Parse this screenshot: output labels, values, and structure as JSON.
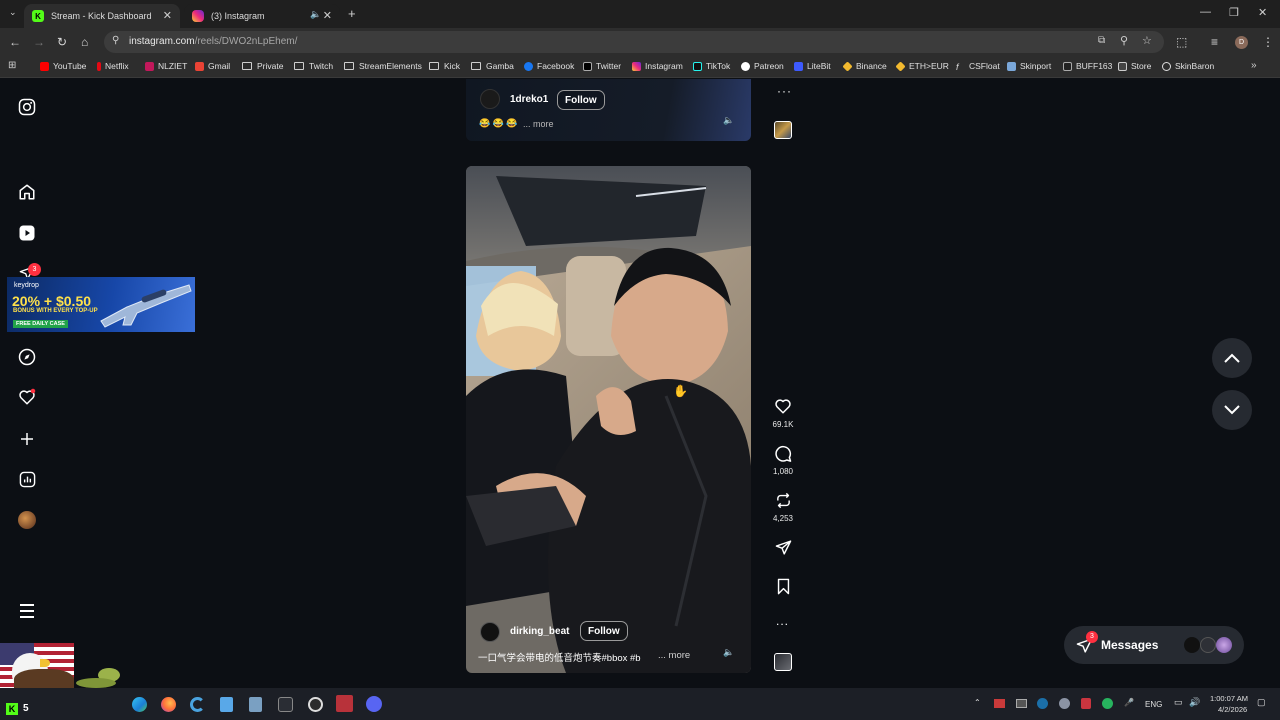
{
  "browser": {
    "tabs": [
      {
        "title": "Stream - Kick Dashboard",
        "icon": "kick-icon",
        "active": true
      },
      {
        "title": "(3) Instagram",
        "icon": "instagram-icon",
        "active": false
      }
    ],
    "new_tab_glyph": "+",
    "url": {
      "host": "instagram.com",
      "path": "/reels/DWO2nLpEhem/"
    },
    "bookmarks": [
      "YouTube",
      "Netflix",
      "NLZIET",
      "Gmail",
      "Private",
      "Twitch",
      "StreamElements",
      "Kick",
      "Gamba",
      "Facebook",
      "Twitter",
      "Instagram",
      "TikTok",
      "Patreon",
      "LiteBit",
      "Binance",
      "ETH>EUR",
      "CSFloat",
      "Skinport",
      "BUFF163",
      "Store",
      "SkinBaron"
    ]
  },
  "sidebar": {
    "notification_badge": "3",
    "icons": [
      "instagram-logo-icon",
      "home-icon",
      "reels-icon",
      "messages-icon",
      "explore-icon",
      "notifications-heart-icon",
      "create-plus-icon",
      "dashboard-icon",
      "profile-avatar",
      "menu-icon"
    ]
  },
  "ad": {
    "brand": "keydrop",
    "headline": "20% + $0.50",
    "subline": "BONUS WITH EVERY TOP-UP",
    "tag": "FREE DAILY CASE"
  },
  "reel_top": {
    "username": "1dreko1",
    "follow_label": "Follow",
    "caption_emoji": "😂 😂 😂",
    "more_label": "... more"
  },
  "reel_main": {
    "username": "dirking_beat",
    "follow_label": "Follow",
    "caption": "一口气学会带电的低音炮节奏#bbox #b",
    "more_label": "... more"
  },
  "actions": {
    "likes": "69.1K",
    "comments": "1,080",
    "reposts": "4,253",
    "more_glyph": "..."
  },
  "messages": {
    "label": "Messages",
    "badge": "3"
  },
  "taskbar": {
    "kick_count": "5",
    "language": "ENG",
    "time": "1:00:07 AM",
    "date": "4/2/2026"
  },
  "colors": {
    "accent_kick": "#53fc18",
    "badge_red": "#ff3040",
    "ig_bg": "#0c0f14"
  }
}
